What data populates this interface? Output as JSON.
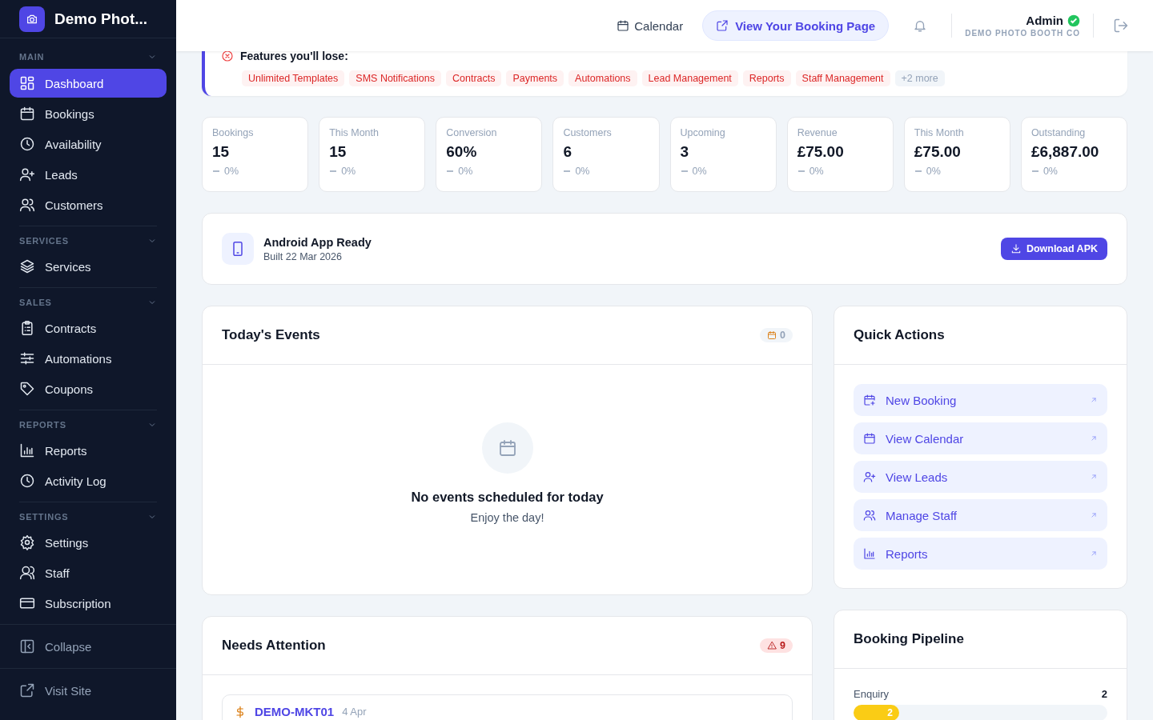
{
  "brand": {
    "name": "Demo Phot..."
  },
  "sidebar": {
    "sections": [
      {
        "label": "MAIN",
        "expanded": true,
        "items": [
          {
            "label": "Dashboard",
            "selected": true
          },
          {
            "label": "Bookings",
            "selected": false
          },
          {
            "label": "Availability",
            "selected": false
          },
          {
            "label": "Leads",
            "selected": false
          },
          {
            "label": "Customers",
            "selected": false
          }
        ]
      },
      {
        "label": "SERVICES",
        "expanded": true,
        "items": [
          {
            "label": "Services",
            "selected": false
          }
        ]
      },
      {
        "label": "SALES",
        "expanded": true,
        "items": [
          {
            "label": "Contracts",
            "selected": false
          },
          {
            "label": "Automations",
            "selected": false
          },
          {
            "label": "Coupons",
            "selected": false
          }
        ]
      },
      {
        "label": "REPORTS",
        "expanded": true,
        "items": [
          {
            "label": "Reports",
            "selected": false
          },
          {
            "label": "Activity Log",
            "selected": false
          }
        ]
      },
      {
        "label": "SETTINGS",
        "expanded": true,
        "items": [
          {
            "label": "Settings",
            "selected": false
          },
          {
            "label": "Staff",
            "selected": false
          },
          {
            "label": "Subscription",
            "selected": false
          }
        ]
      }
    ],
    "collapse": "Collapse",
    "visit_site": "Visit Site"
  },
  "header": {
    "calendar": "Calendar",
    "booking_page": "View Your Booking Page",
    "user": {
      "name": "Admin",
      "verified": true,
      "company": "DEMO PHOTO BOOTH CO"
    }
  },
  "banner": {
    "title": "Features you'll lose:",
    "features": [
      "Unlimited Templates",
      "SMS Notifications",
      "Contracts",
      "Payments",
      "Automations",
      "Lead Management",
      "Reports",
      "Staff Management"
    ],
    "more": "+2 more"
  },
  "stats": [
    {
      "label": "Bookings",
      "value": "15",
      "change": "0%"
    },
    {
      "label": "This Month",
      "value": "15",
      "change": "0%"
    },
    {
      "label": "Conversion",
      "value": "60%",
      "change": "0%"
    },
    {
      "label": "Customers",
      "value": "6",
      "change": "0%"
    },
    {
      "label": "Upcoming",
      "value": "3",
      "change": "0%"
    },
    {
      "label": "Revenue",
      "value": "£75.00",
      "change": "0%"
    },
    {
      "label": "This Month",
      "value": "£75.00",
      "change": "0%"
    },
    {
      "label": "Outstanding",
      "value": "£6,887.00",
      "change": "0%"
    }
  ],
  "app_card": {
    "title": "Android App Ready",
    "subtitle": "Built 22 Mar 2026",
    "button": "Download APK"
  },
  "todays_events": {
    "title": "Today's Events",
    "count": "0",
    "empty_title": "No events scheduled for today",
    "empty_text": "Enjoy the day!"
  },
  "needs_attention": {
    "title": "Needs Attention",
    "count": "9",
    "items": [
      {
        "ref": "DEMO-MKT01",
        "date": "4 Apr"
      }
    ]
  },
  "quick_actions": {
    "title": "Quick Actions",
    "items": [
      "New Booking",
      "View Calendar",
      "View Leads",
      "Manage Staff",
      "Reports"
    ]
  },
  "pipeline": {
    "title": "Booking Pipeline",
    "stages": [
      {
        "label": "Enquiry",
        "total": "2",
        "bar_label": "2",
        "level": 0.18
      }
    ]
  }
}
